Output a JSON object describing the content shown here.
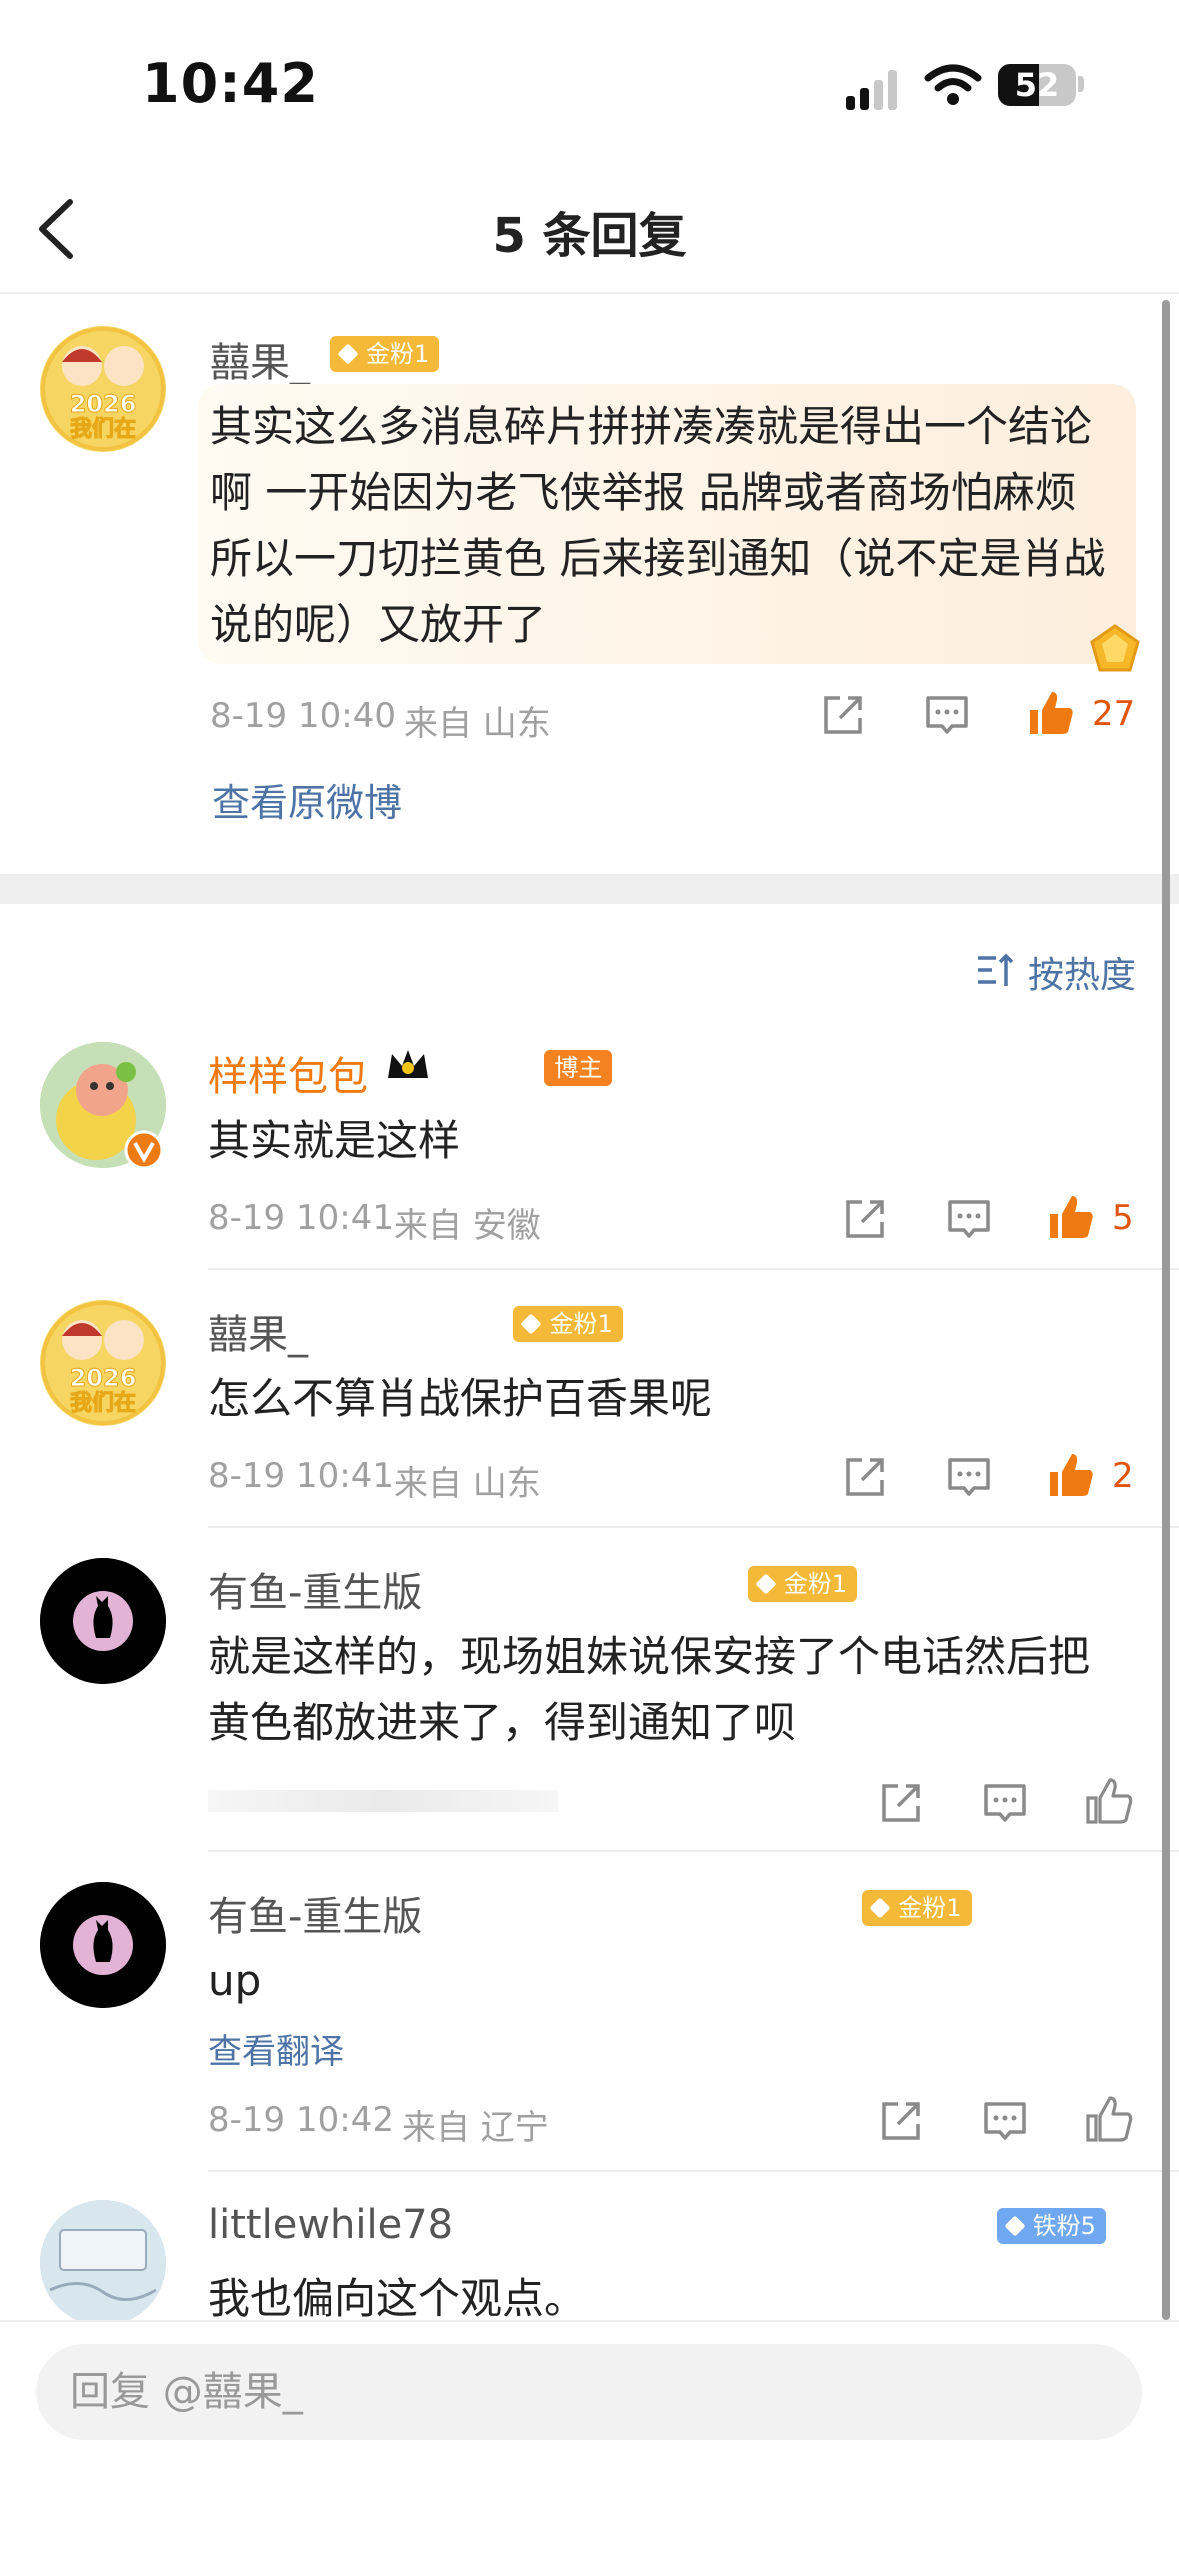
{
  "status_bar": {
    "time": "10:42",
    "battery": "52"
  },
  "nav": {
    "title": "5 条回复"
  },
  "main_comment": {
    "user": "囍果_",
    "badge": "金粉1",
    "text": "其实这么多消息碎片拼拼凑凑就是得出一个结论啊 一开始因为老飞侠举报 品牌或者商场怕麻烦所以一刀切拦黄色 后来接到通知（说不定是肖战说的呢）又放开了",
    "time": "8-19 10:40",
    "location": "来自 山东",
    "likes": "27",
    "view_original": "查看原微博"
  },
  "sort": {
    "label": "按热度"
  },
  "replies": [
    {
      "user": "样样包包",
      "badge": "博主",
      "text": "其实就是这样",
      "time": "8-19 10:41",
      "location": "来自 安徽",
      "likes": "5"
    },
    {
      "user": "囍果_",
      "badge": "金粉1",
      "text": "怎么不算肖战保护百香果呢",
      "time": "8-19 10:41",
      "location": "来自 山东",
      "likes": "2"
    },
    {
      "user": "有鱼-重生版",
      "badge": "金粉1",
      "text": "就是这样的，现场姐妹说保安接了个电话然后把黄色都放进来了，得到通知了呗"
    },
    {
      "user": "有鱼-重生版",
      "badge": "金粉1",
      "text": "up",
      "translate": "查看翻译",
      "time": "8-19 10:42",
      "location": "来自 辽宁"
    },
    {
      "user": "littlewhile78",
      "badge": "铁粉5",
      "text": "我也偏向这个观点。"
    }
  ],
  "reply_input": {
    "placeholder": "回复 @囍果_"
  },
  "colors": {
    "accent_orange": "#e0560e",
    "link_blue": "#4e74a6",
    "gold_badge": "#f5b93a",
    "iron_badge": "#6fa8f0"
  }
}
